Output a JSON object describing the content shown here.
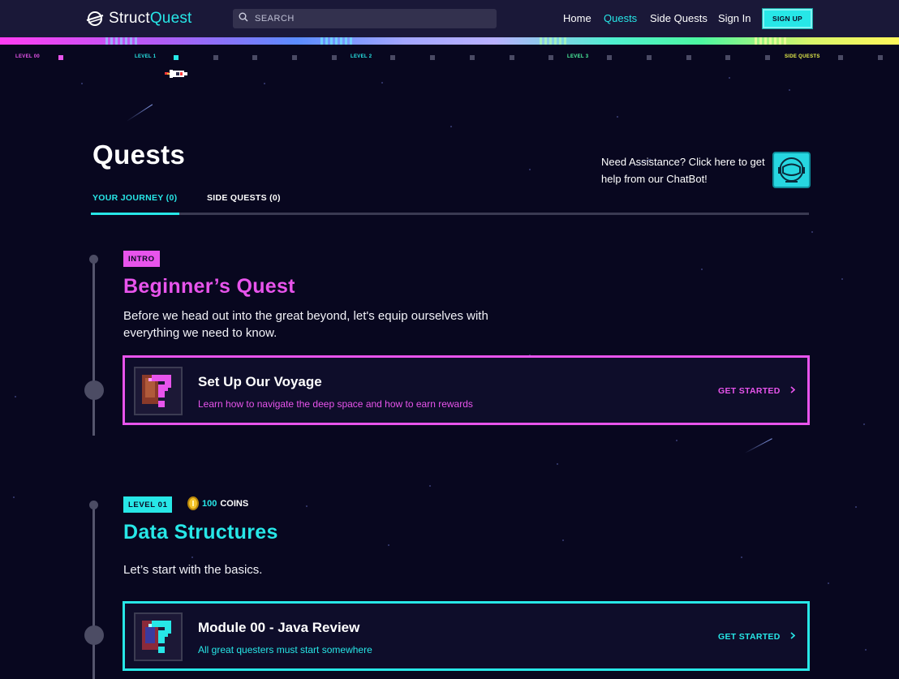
{
  "nav": {
    "logo_word1": "Struct",
    "logo_word2": "Quest",
    "search_placeholder": "SEARCH",
    "links": [
      "Home",
      "Quests",
      "Side Quests",
      "Sign In"
    ],
    "active_link": "Quests",
    "signup_label": "SIGN UP"
  },
  "progress_track": {
    "labels": [
      "LEVEL 00",
      "LEVEL 1",
      "LEVEL 2",
      "LEVEL 3",
      "SIDE QUESTS"
    ]
  },
  "page": {
    "title": "Quests",
    "assistance_text": "Need Assistance? Click here to get help from our ChatBot!",
    "tabs": [
      {
        "label": "YOUR JOURNEY (0)",
        "active": true
      },
      {
        "label": "SIDE QUESTS (0)",
        "active": false
      }
    ]
  },
  "sections": [
    {
      "badge": "INTRO",
      "title": "Beginner’s Quest",
      "description": "Before we head out into the great beyond, let's equip ourselves with everything we need to know.",
      "accent": "#e854ec",
      "card": {
        "title": "Set Up Our Voyage",
        "subtitle": "Learn how to navigate the deep space and how to earn rewards",
        "button": "GET STARTED"
      }
    },
    {
      "badge": "LEVEL 01",
      "coins_amount": "100",
      "coins_label": "COINS",
      "title": "Data Structures",
      "description": "Let’s start with the basics.",
      "accent": "#27e7e7",
      "card": {
        "title": "Module 00 - Java Review",
        "subtitle": "All great questers must start somewhere",
        "button": "GET STARTED"
      }
    }
  ],
  "colors": {
    "background": "#08071f",
    "nav": "#1a1838",
    "cyan": "#27e7e7",
    "magenta": "#e854ec",
    "level_yellow": "#e8f04a"
  }
}
